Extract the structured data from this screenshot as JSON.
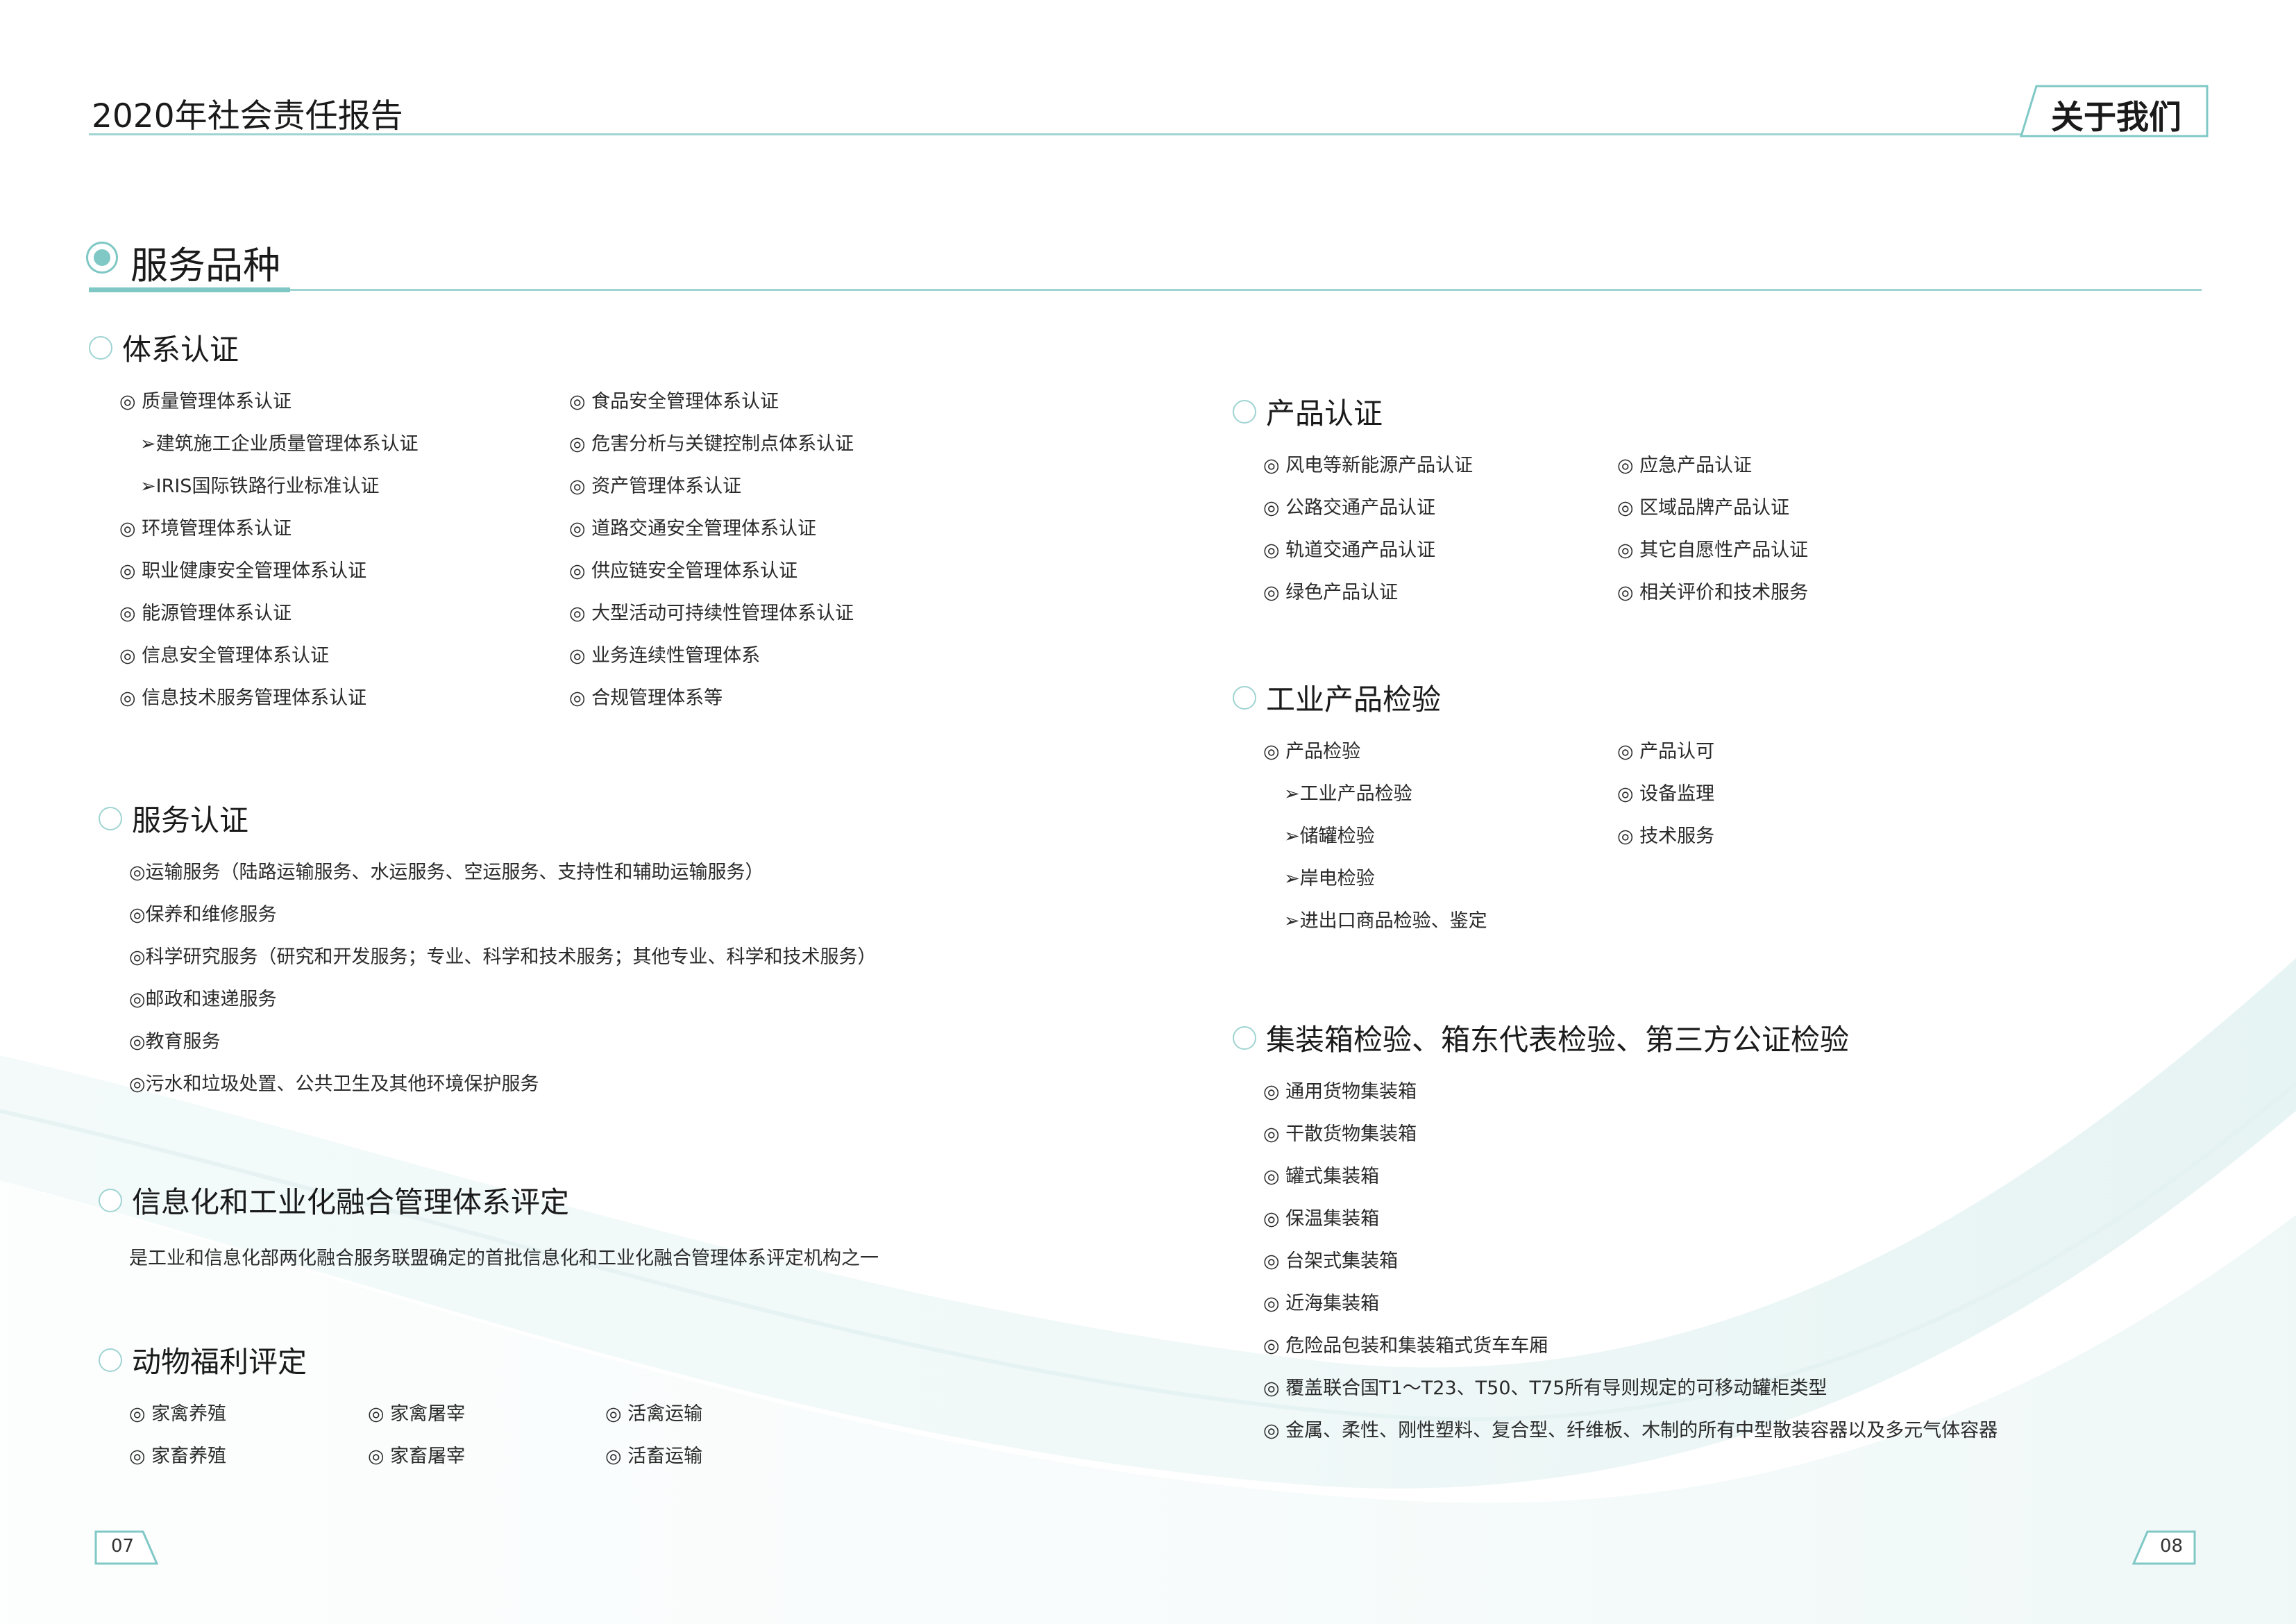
{
  "header": {
    "report_title": "2020年社会责任报告",
    "section_tab": "关于我们"
  },
  "main": {
    "title": "服务品种"
  },
  "system_cert": {
    "title": "体系认证",
    "col1": [
      {
        "text": "◎ 质量管理体系认证",
        "sub": false
      },
      {
        "text": "➢建筑施工企业质量管理体系认证",
        "sub": true
      },
      {
        "text": "➢IRIS国际铁路行业标准认证",
        "sub": true
      },
      {
        "text": "◎ 环境管理体系认证",
        "sub": false
      },
      {
        "text": "◎ 职业健康安全管理体系认证",
        "sub": false
      },
      {
        "text": "◎ 能源管理体系认证",
        "sub": false
      },
      {
        "text": "◎ 信息安全管理体系认证",
        "sub": false
      },
      {
        "text": "◎ 信息技术服务管理体系认证",
        "sub": false
      }
    ],
    "col2": [
      {
        "text": "◎ 食品安全管理体系认证",
        "sub": false
      },
      {
        "text": "◎ 危害分析与关键控制点体系认证",
        "sub": false
      },
      {
        "text": "◎ 资产管理体系认证",
        "sub": false
      },
      {
        "text": "◎ 道路交通安全管理体系认证",
        "sub": false
      },
      {
        "text": "◎ 供应链安全管理体系认证",
        "sub": false
      },
      {
        "text": "◎ 大型活动可持续性管理体系认证",
        "sub": false
      },
      {
        "text": "◎ 业务连续性管理体系",
        "sub": false
      },
      {
        "text": "◎ 合规管理体系等",
        "sub": false
      }
    ]
  },
  "service_cert": {
    "title": "服务认证",
    "items": [
      {
        "text": "◎运输服务（陆路运输服务、水运服务、空运服务、支持性和辅助运输服务）",
        "sub": false
      },
      {
        "text": "◎保养和维修服务",
        "sub": false
      },
      {
        "text": "◎科学研究服务（研究和开发服务；专业、科学和技术服务；其他专业、科学和技术服务）",
        "sub": false
      },
      {
        "text": "◎邮政和速递服务",
        "sub": false
      },
      {
        "text": "◎教育服务",
        "sub": false
      },
      {
        "text": "◎污水和垃圾处置、公共卫生及其他环境保护服务",
        "sub": false
      }
    ]
  },
  "it_integration": {
    "title": "信息化和工业化融合管理体系评定",
    "desc": "是工业和信息化部两化融合服务联盟确定的首批信息化和工业化融合管理体系评定机构之一"
  },
  "animal_welfare": {
    "title": "动物福利评定",
    "col1": [
      {
        "text": "◎ 家禽养殖",
        "sub": false
      },
      {
        "text": "◎ 家畜养殖",
        "sub": false
      }
    ],
    "col2": [
      {
        "text": "◎ 家禽屠宰",
        "sub": false
      },
      {
        "text": "◎ 家畜屠宰",
        "sub": false
      }
    ],
    "col3": [
      {
        "text": "◎ 活禽运输",
        "sub": false
      },
      {
        "text": "◎ 活畜运输",
        "sub": false
      }
    ]
  },
  "product_cert": {
    "title": "产品认证",
    "col1": [
      {
        "text": "◎ 风电等新能源产品认证",
        "sub": false
      },
      {
        "text": "◎ 公路交通产品认证",
        "sub": false
      },
      {
        "text": "◎ 轨道交通产品认证",
        "sub": false
      },
      {
        "text": "◎ 绿色产品认证",
        "sub": false
      }
    ],
    "col2": [
      {
        "text": "◎ 应急产品认证",
        "sub": false
      },
      {
        "text": "◎ 区域品牌产品认证",
        "sub": false
      },
      {
        "text": "◎ 其它自愿性产品认证",
        "sub": false
      },
      {
        "text": "◎ 相关评价和技术服务",
        "sub": false
      }
    ]
  },
  "industrial_inspection": {
    "title": "工业产品检验",
    "col1": [
      {
        "text": "◎ 产品检验",
        "sub": false
      },
      {
        "text": "➢工业产品检验",
        "sub": true
      },
      {
        "text": "➢储罐检验",
        "sub": true
      },
      {
        "text": "➢岸电检验",
        "sub": true
      },
      {
        "text": "➢进出口商品检验、鉴定",
        "sub": true
      }
    ],
    "col2": [
      {
        "text": "◎ 产品认可",
        "sub": false
      },
      {
        "text": "◎ 设备监理",
        "sub": false
      },
      {
        "text": "◎ 技术服务",
        "sub": false
      }
    ]
  },
  "container_inspection": {
    "title": "集装箱检验、箱东代表检验、第三方公证检验",
    "items": [
      {
        "text": "◎ 通用货物集装箱",
        "sub": false
      },
      {
        "text": "◎ 干散货物集装箱",
        "sub": false
      },
      {
        "text": "◎ 罐式集装箱",
        "sub": false
      },
      {
        "text": "◎ 保温集装箱",
        "sub": false
      },
      {
        "text": "◎ 台架式集装箱",
        "sub": false
      },
      {
        "text": "◎ 近海集装箱",
        "sub": false
      },
      {
        "text": "◎ 危险品包装和集装箱式货车车厢",
        "sub": false
      },
      {
        "text": "◎ 覆盖联合国T1～T23、T50、T75所有导则规定的可移动罐柜类型",
        "sub": false
      },
      {
        "text": "◎ 金属、柔性、刚性塑料、复合型、纤维板、木制的所有中型散装容器以及多元气体容器",
        "sub": false
      }
    ]
  },
  "footer": {
    "page_left": "07",
    "page_right": "08"
  },
  "colors": {
    "accent": "#7fc8c5",
    "accent_light": "#bfe3e1"
  }
}
